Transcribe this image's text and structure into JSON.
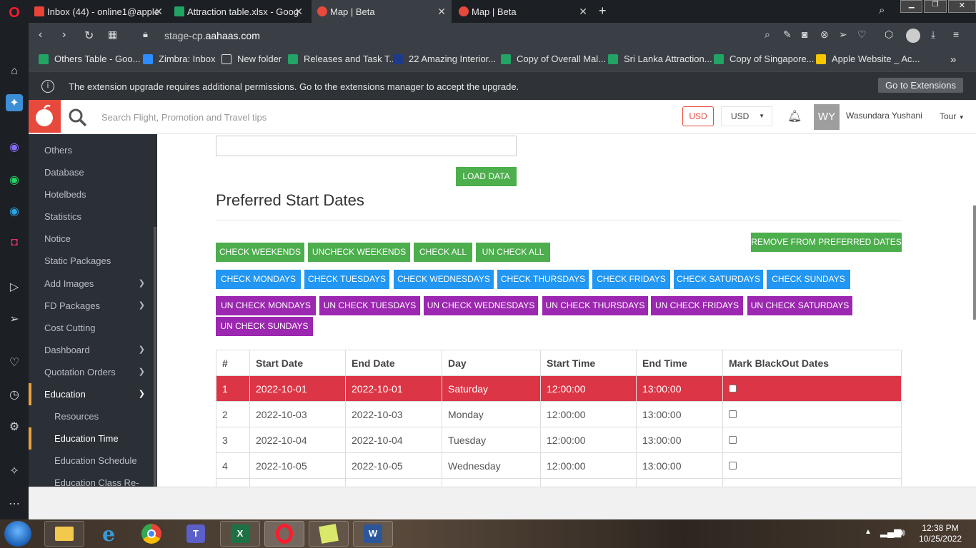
{
  "browser": {
    "tabs": [
      {
        "label": "Inbox (44) - online1@apple",
        "color": "#e84437"
      },
      {
        "label": "Attraction table.xlsx - Goog",
        "color": "#21a464"
      },
      {
        "label": "Map | Beta",
        "color": "#e8493d"
      },
      {
        "label": "Map | Beta",
        "color": "#e8493d"
      }
    ],
    "url_prefix": "stage-cp.",
    "url_domain": "aahaas.com",
    "bookmarks": [
      "Others Table - Goo...",
      "Zimbra: Inbox",
      "New folder",
      "Releases and Task T...",
      "22 Amazing Interior...",
      "Copy of Overall Mal...",
      "Sri Lanka Attraction...",
      "Copy of Singapore...",
      "Apple Website _ Ac..."
    ],
    "infobar_message": "The extension upgrade requires additional permissions. Go to the extensions manager to accept the upgrade.",
    "infobar_button": "Go to Extensions"
  },
  "header": {
    "search_placeholder": "Search Flight, Promotion and Travel tips",
    "currency_badge": "USD",
    "currency_select": "USD",
    "avatar_initials": "WY",
    "user_name": "Wasundara Yushani",
    "tour_menu": "Tour"
  },
  "sidebar": {
    "items": [
      {
        "label": "Others"
      },
      {
        "label": "Database"
      },
      {
        "label": "Hotelbeds"
      },
      {
        "label": "Statistics"
      },
      {
        "label": "Notice"
      },
      {
        "label": "Static Packages"
      },
      {
        "label": "Add Images"
      },
      {
        "label": "FD Packages"
      },
      {
        "label": "Cost Cutting"
      },
      {
        "label": "Dashboard"
      },
      {
        "label": "Quotation Orders"
      },
      {
        "label": "Education"
      },
      {
        "label": "Resources"
      },
      {
        "label": "Education Time"
      },
      {
        "label": "Education Schedule"
      },
      {
        "label": "Education Class Re-"
      }
    ]
  },
  "main": {
    "load_button": "LOAD DATA",
    "section_title": "Preferred Start Dates",
    "remove_button": "REMOVE FROM PREFERRED DATES",
    "row1": [
      "CHECK WEEKENDS",
      "UNCHECK WEEKENDS",
      "CHECK ALL",
      "UN CHECK ALL"
    ],
    "row2": [
      "CHECK MONDAYS",
      "CHECK TUESDAYS",
      "CHECK WEDNESDAYS",
      "CHECK THURSDAYS",
      "CHECK FRIDAYS",
      "CHECK SATURDAYS",
      "CHECK SUNDAYS"
    ],
    "row3": [
      "UN CHECK MONDAYS",
      "UN CHECK TUESDAYS",
      "UN CHECK WEDNESDAYS",
      "UN CHECK THURSDAYS",
      "UN CHECK FRIDAYS",
      "UN CHECK SATURDAYS"
    ],
    "row4": [
      "UN CHECK SUNDAYS"
    ],
    "table": {
      "headers": [
        "#",
        "Start Date",
        "End Date",
        "Day",
        "Start Time",
        "End Time",
        "Mark BlackOut Dates"
      ],
      "rows": [
        [
          "1",
          "2022-10-01",
          "2022-10-01",
          "Saturday",
          "12:00:00",
          "13:00:00"
        ],
        [
          "2",
          "2022-10-03",
          "2022-10-03",
          "Monday",
          "12:00:00",
          "13:00:00"
        ],
        [
          "3",
          "2022-10-04",
          "2022-10-04",
          "Tuesday",
          "12:00:00",
          "13:00:00"
        ],
        [
          "4",
          "2022-10-05",
          "2022-10-05",
          "Wednesday",
          "12:00:00",
          "13:00:00"
        ]
      ]
    }
  },
  "taskbar": {
    "time": "12:38 PM",
    "date": "10/25/2022"
  }
}
